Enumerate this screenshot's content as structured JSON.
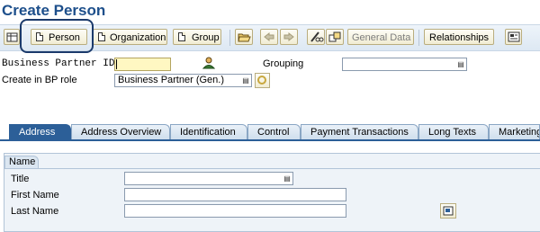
{
  "app": {
    "title": "Create Person"
  },
  "toolbar": {
    "person_label": "Person",
    "organization_label": "Organization",
    "group_label": "Group",
    "general_data_label": "General Data",
    "relationships_label": "Relationships"
  },
  "icons": {
    "first": "table-icon",
    "open": "folder-open-icon",
    "prev": "arrow-left-icon",
    "next": "arrow-right-icon",
    "edit": "pencil-glasses-icon",
    "switch": "switch-mode-icon",
    "last": "settings-screen-icon",
    "partner": "person-icon",
    "role_detail": "role-detail-icon",
    "address_detail": "address-detail-icon"
  },
  "header": {
    "bp_id_label": "Business Partner ID",
    "bp_id_value": "",
    "grouping_label": "Grouping",
    "grouping_value": "",
    "role_label": "Create in BP role",
    "role_value": "Business Partner (Gen.)"
  },
  "tabs": [
    {
      "label": "Address",
      "active": true
    },
    {
      "label": "Address Overview"
    },
    {
      "label": "Identification"
    },
    {
      "label": "Control"
    },
    {
      "label": "Payment Transactions"
    },
    {
      "label": "Long Texts"
    },
    {
      "label": "Marketing"
    }
  ],
  "name_group": {
    "title": "Name",
    "title_label": "Title",
    "title_value": "",
    "first_name_label": "First Name",
    "first_name_value": "",
    "last_name_label": "Last Name",
    "last_name_value": ""
  },
  "colors": {
    "title_blue": "#1d4f8b",
    "tab_active": "#2c5f98",
    "highlight_frame": "#1b3a6b",
    "required_field": "#fff7c2"
  }
}
